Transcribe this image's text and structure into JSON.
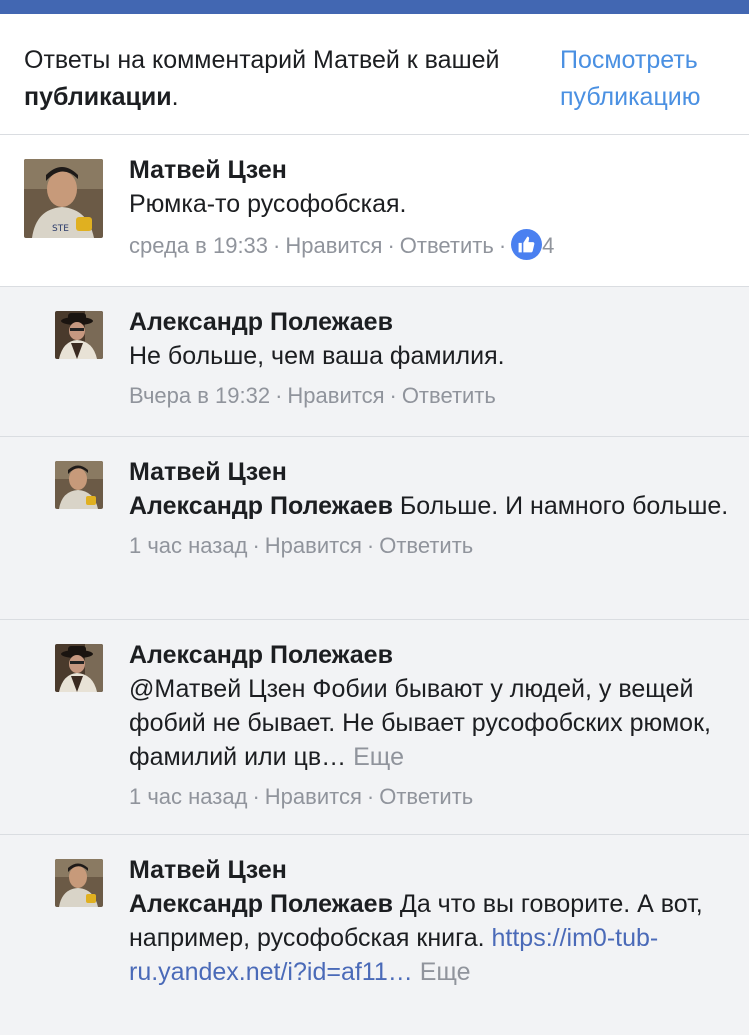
{
  "header": {
    "title_prefix": "Ответы на комментарий Матвей к вашей ",
    "title_bold": "публикации",
    "title_suffix": ".",
    "view_link": "Посмотреть публикацию"
  },
  "comment": {
    "author": "Матвей Цзен",
    "text": "Рюмка-то русофобская.",
    "time": "среда в 19:33",
    "like_label": "Нравится",
    "reply_label": "Ответить",
    "reaction_count": "4"
  },
  "replies": [
    {
      "author": "Александр Полежаев",
      "mention": "",
      "text": "Не больше, чем ваша фамилия.",
      "link": "",
      "more": "",
      "time": "Вчера в 19:32",
      "like_label": "Нравится",
      "reply_label": "Ответить"
    },
    {
      "author": "Матвей Цзен",
      "mention": "Александр Полежаев",
      "text": " Больше. И намного больше.",
      "link": "",
      "more": "",
      "time": "1 час назад",
      "like_label": "Нравится",
      "reply_label": "Ответить"
    },
    {
      "author": "Александр Полежаев",
      "mention": "",
      "text": "@Матвей Цзен Фобии бывают у людей, у вещей фобий не бывает. Не бывает русофобских рюмок, фамилий или цв…",
      "link": "",
      "more": " Еще",
      "time": "1 час назад",
      "like_label": "Нравится",
      "reply_label": "Ответить"
    },
    {
      "author": "Матвей Цзен",
      "mention": "Александр Полежаев",
      "text": " Да что вы говорите. А вот, например, русофобская книга. ",
      "link": "https://im0-tub-ru.yandex.net/i?id=af11…",
      "more": " Еще",
      "time": "",
      "like_label": "",
      "reply_label": ""
    }
  ],
  "colors": {
    "brand_bar": "#4267b2",
    "link": "#4a90e2",
    "like_badge": "#4a80f0",
    "reply_bg": "#f2f3f5"
  },
  "icons": {
    "like": "thumbs-up-icon"
  }
}
